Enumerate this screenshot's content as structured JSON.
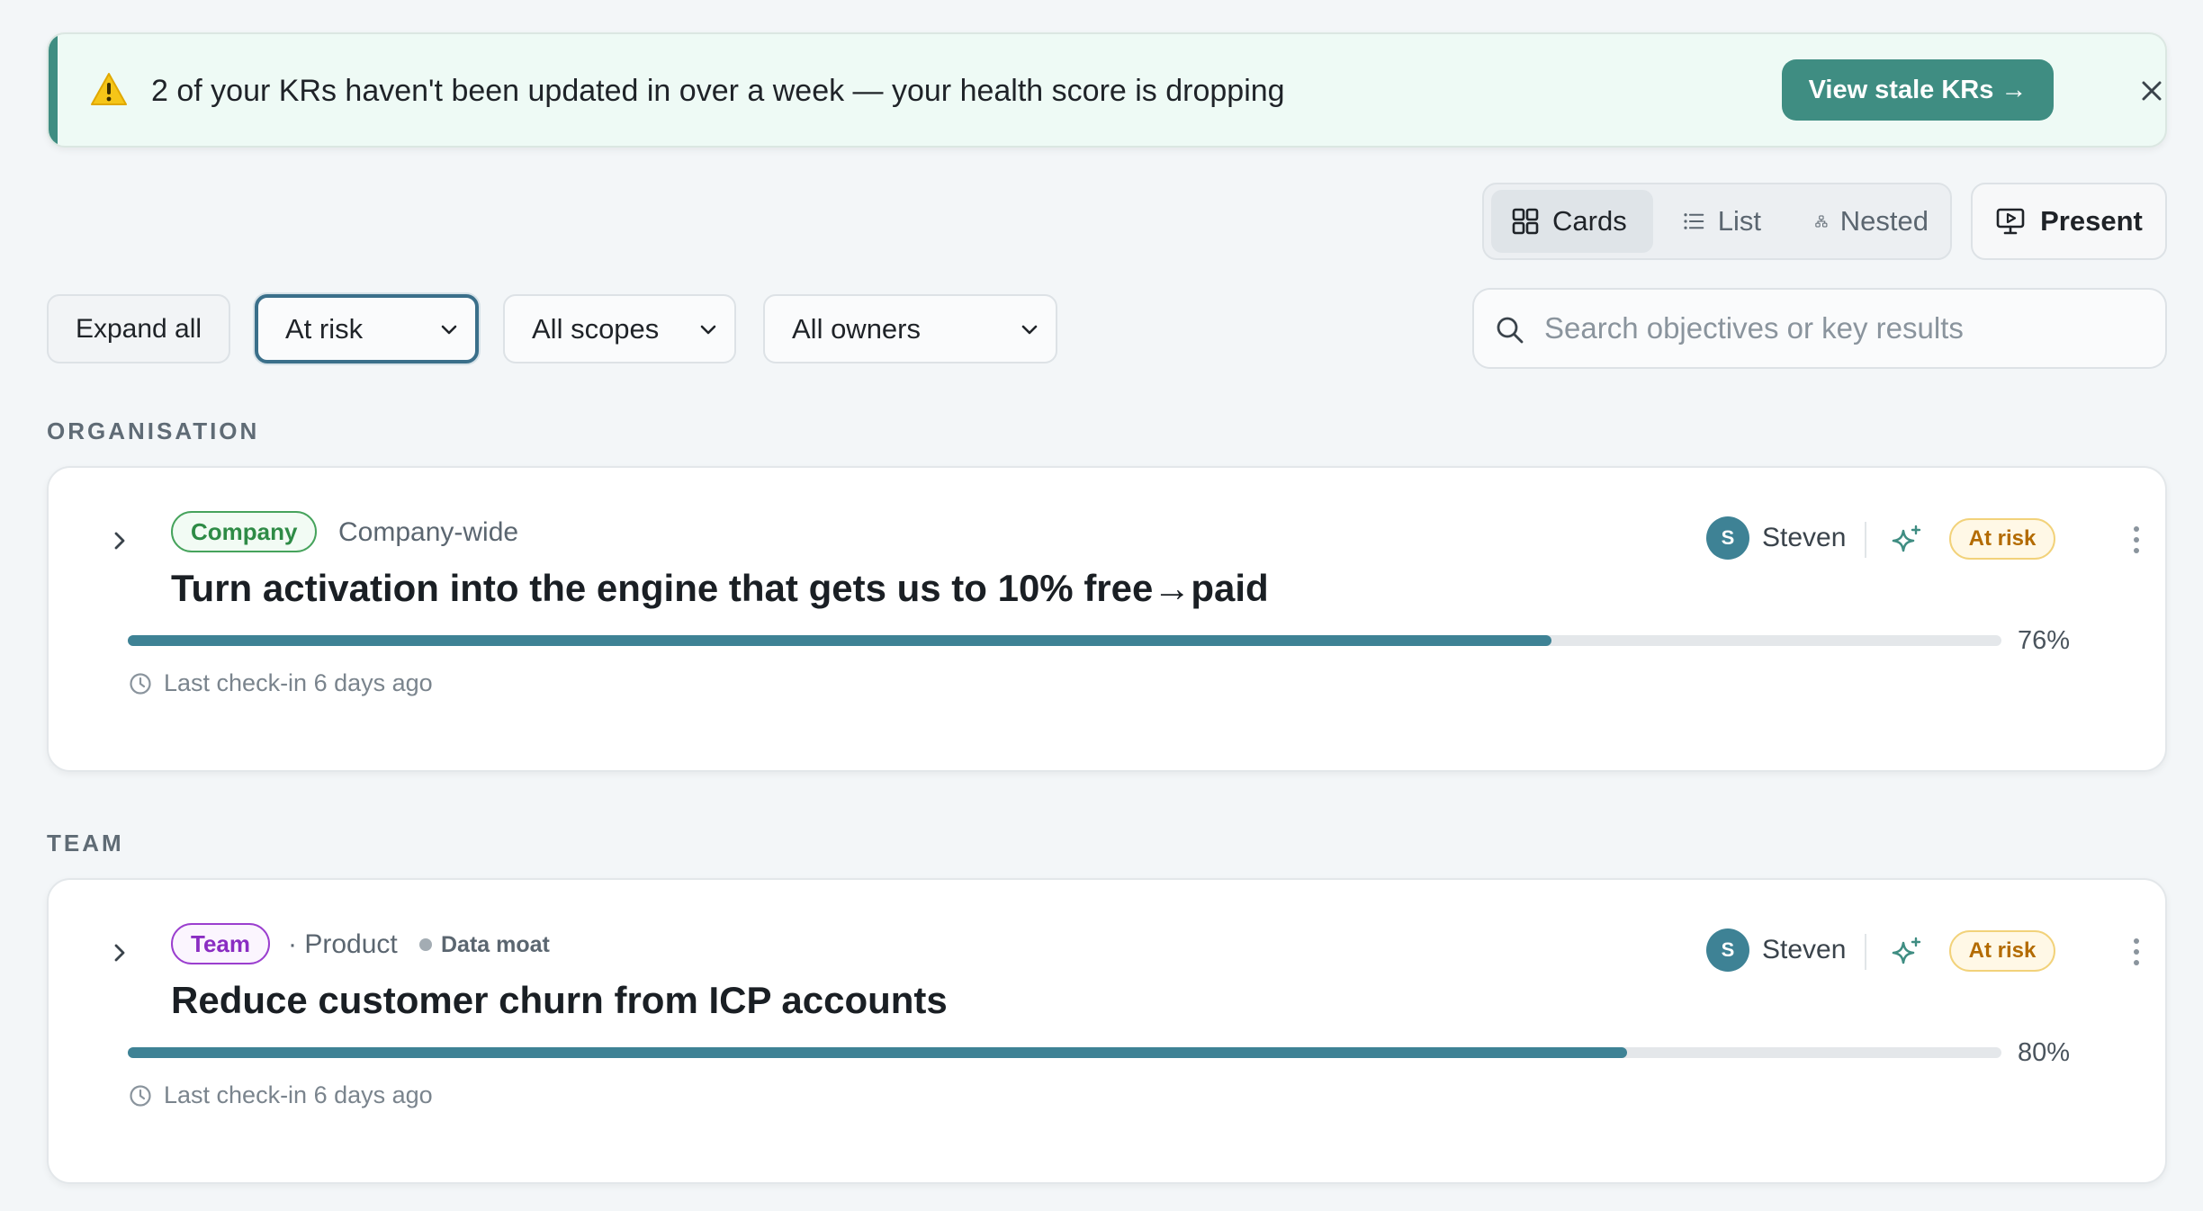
{
  "banner": {
    "message": "2 of your KRs haven't been updated in over a week — your health score is dropping",
    "action_label": "View stale KRs →",
    "accent_color": "#3f8d82",
    "icon": "warning-icon"
  },
  "view_switcher": {
    "options": [
      {
        "label": "Cards",
        "icon": "grid-icon",
        "active": true
      },
      {
        "label": "List",
        "icon": "list-icon",
        "active": false
      },
      {
        "label": "Nested",
        "icon": "hierarchy-icon",
        "active": false
      }
    ],
    "present_label": "Present"
  },
  "filters": {
    "expand_label": "Expand all",
    "status_select": "At risk",
    "scope_select": "All scopes",
    "owner_select": "All owners",
    "search_placeholder": "Search objectives or key results"
  },
  "sections": [
    {
      "label": "ORGANISATION",
      "objective": {
        "tag": "Company",
        "scope": "Company-wide",
        "title": "Turn activation into the engine that gets us to 10% free→paid",
        "progress_percent": 76,
        "progress_label": "76%",
        "checkin": "Last check-in 6 days ago",
        "owner_initial": "S",
        "owner_name": "Steven",
        "status": "At risk"
      }
    },
    {
      "label": "TEAM",
      "objective": {
        "tag": "Team",
        "scope": "· Product",
        "extra_tag": "Data moat",
        "title": "Reduce customer churn from ICP accounts",
        "progress_percent": 80,
        "progress_label": "80%",
        "checkin": "Last check-in 6 days ago",
        "owner_initial": "S",
        "owner_name": "Steven",
        "status": "At risk"
      }
    }
  ],
  "colors": {
    "progress_fill": "#3e8295",
    "at_risk_text": "#b36b00",
    "company_tag": "#2e8b46",
    "team_tag": "#8a2dc2"
  }
}
